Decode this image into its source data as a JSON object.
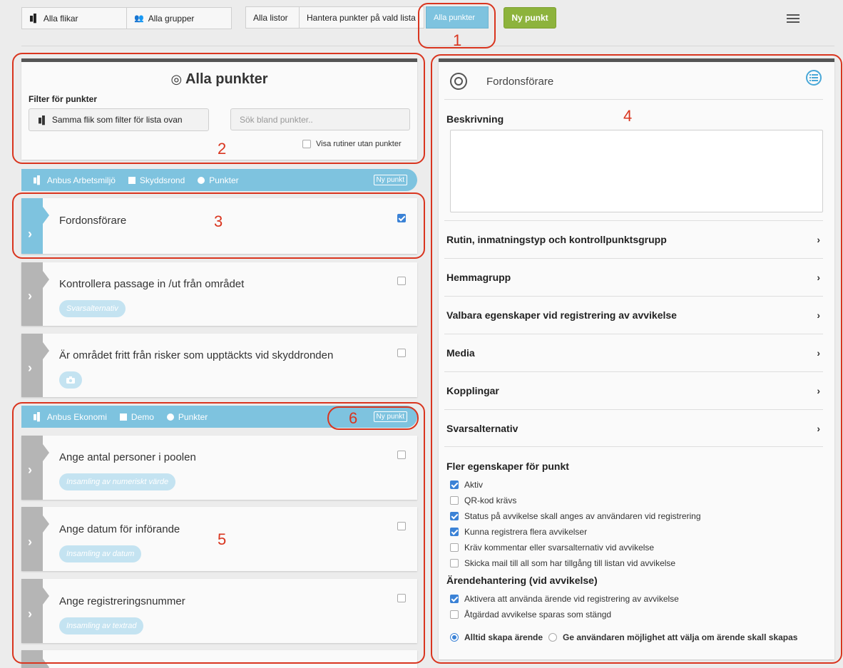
{
  "toolbar": {
    "all_tabs": "Alla flikar",
    "all_groups": "Alla grupper",
    "all_lists": "Alla listor",
    "manage_points": "Hantera punkter på vald lista",
    "all_points": "Alla punkter",
    "new_point": "Ny punkt",
    "menu_icon": "hamburger-menu-icon"
  },
  "filter": {
    "title": "Alla punkter",
    "label": "Filter för punkter",
    "same_tab_button": "Samma flik som filter för lista ovan",
    "search_placeholder": "Sök bland punkter..",
    "show_routines_label": "Visa rutiner utan punkter"
  },
  "groups": [
    {
      "tab": "Anbus Arbetsmiljö",
      "list": "Skyddsrond",
      "type": "Punkter",
      "new_label": "Ny punkt",
      "items": [
        {
          "title": "Fordonsförare",
          "tag": "",
          "checked": true,
          "selected": true
        },
        {
          "title": "Kontrollera passage in /ut från området",
          "tag": "Svarsalternativ",
          "checked": false
        },
        {
          "title": "Är området fritt från risker som upptäckts vid skyddronden",
          "tag": "camera-icon",
          "checked": false
        }
      ]
    },
    {
      "tab": "Anbus Ekonomi",
      "list": "Demo",
      "type": "Punkter",
      "new_label": "Ny punkt",
      "items": [
        {
          "title": "Ange antal personer i poolen",
          "tag": "Insamling av numeriskt värde",
          "checked": false
        },
        {
          "title": "Ange datum för införande",
          "tag": "Insamling av datum",
          "checked": false
        },
        {
          "title": "Ange registreringsnummer",
          "tag": "Insamling av textrad",
          "checked": false
        }
      ]
    }
  ],
  "detail": {
    "title": "Fordonsförare",
    "description_label": "Beskrivning",
    "sections": [
      "Rutin, inmatningstyp och kontrollpunktsgrupp",
      "Hemmagrupp",
      "Valbara egenskaper vid registrering av avvikelse",
      "Media",
      "Kopplingar",
      "Svarsalternativ"
    ],
    "more_props_label": "Fler egenskaper för punkt",
    "props": [
      {
        "label": "Aktiv",
        "checked": true
      },
      {
        "label": "QR-kod krävs",
        "checked": false
      },
      {
        "label": "Status på avvikelse skall anges av användaren vid registrering",
        "checked": true
      },
      {
        "label": "Kunna registrera flera avvikelser",
        "checked": true
      },
      {
        "label": "Kräv kommentar eller svarsalternativ vid avvikelse",
        "checked": false
      },
      {
        "label": "Skicka mail till all som har tillgång till listan vid avvikelse",
        "checked": false
      }
    ],
    "case_label": "Ärendehantering (vid avvikelse)",
    "case_props": [
      {
        "label": "Aktivera att använda ärende vid registrering av avvikelse",
        "checked": true
      },
      {
        "label": "Åtgärdad avvikelse sparas som stängd",
        "checked": false
      }
    ],
    "radio_options": [
      {
        "label": "Alltid skapa ärende",
        "selected": true
      },
      {
        "label": "Ge användaren möjlighet att välja om ärende skall skapas",
        "selected": false
      }
    ]
  },
  "annotations": [
    "1",
    "2",
    "3",
    "4",
    "5",
    "6"
  ],
  "colors": {
    "accent_blue": "#7ec3df",
    "green": "#8db33c",
    "annotation_red": "#d9351f",
    "check_blue": "#3b82d6"
  }
}
